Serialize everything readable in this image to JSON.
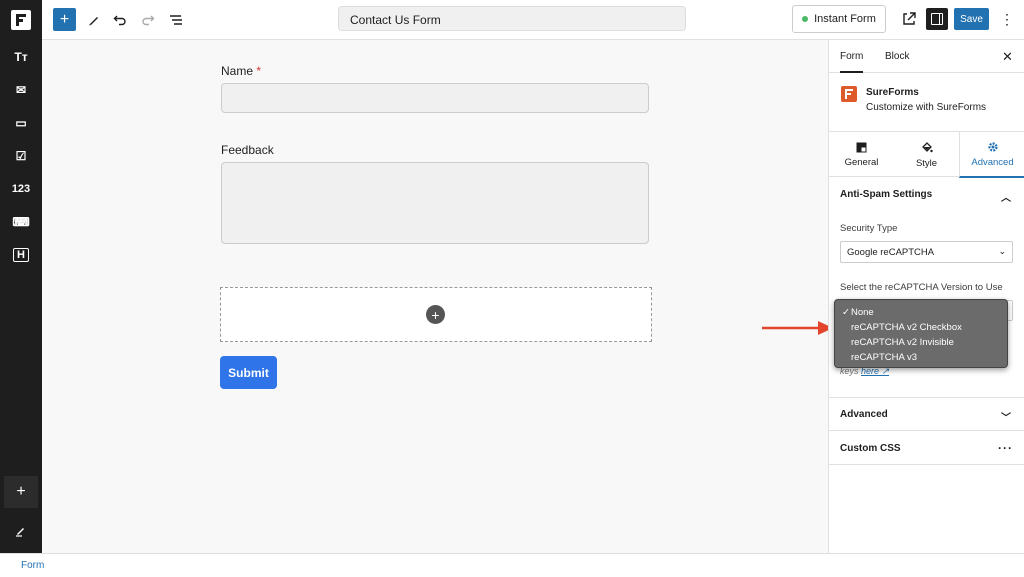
{
  "header": {
    "add_label": "+",
    "document_title": "Contact Us Form",
    "instant_form_label": "Instant Form",
    "save_label": "Save",
    "more_label": "⋮"
  },
  "rail": {
    "items": [
      "Tт",
      "✉",
      "▭",
      "☑",
      "123",
      "⌨",
      "H"
    ],
    "add_label": "+"
  },
  "form": {
    "name_label": "Name",
    "required_mark": "*",
    "feedback_label": "Feedback",
    "add_block_label": "+",
    "submit_label": "Submit"
  },
  "sidebar": {
    "tabs": [
      "Form",
      "Block"
    ],
    "close_label": "✕",
    "brand_title": "SureForms",
    "brand_subtitle": "Customize with SureForms",
    "style_tabs": [
      "General",
      "Style",
      "Advanced"
    ],
    "anti_spam_title": "Anti-Spam Settings",
    "security_type_label": "Security Type",
    "security_type_value": "Google reCAPTCHA",
    "version_label": "Select the reCAPTCHA Version to Use",
    "version_options": [
      "None",
      "reCAPTCHA v2 Checkbox",
      "reCAPTCHA v2 Invisible",
      "reCAPTCHA v3"
    ],
    "version_selected": "None",
    "keys_prefix": "keys",
    "keys_link": "here ↗",
    "advanced_title": "Advanced",
    "custom_css_title": "Custom CSS"
  },
  "footer": {
    "breadcrumb": "Form"
  },
  "colors": {
    "accent": "#2271b1",
    "submit": "#2f74e8",
    "brand": "#dd5a2b",
    "arrow": "#e2452b",
    "required": "#d63638"
  }
}
